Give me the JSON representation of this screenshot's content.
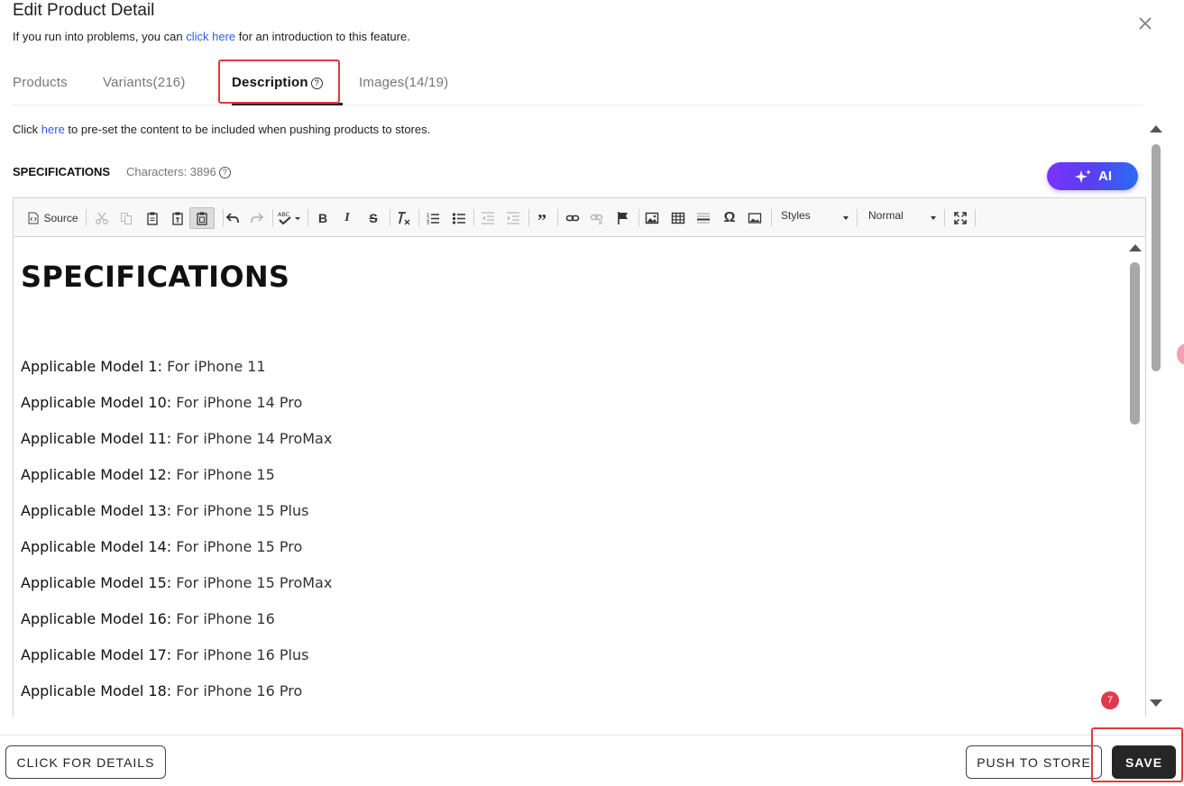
{
  "dialog": {
    "title": "Edit Product Detail",
    "subtitle_before": "If you run into problems, you can ",
    "subtitle_link": "click here",
    "subtitle_after": " for an introduction to this feature."
  },
  "tabs": [
    {
      "label": "Products"
    },
    {
      "label": "Variants(216)"
    },
    {
      "label": "Description",
      "active": true
    },
    {
      "label": "Images(14/19)"
    }
  ],
  "hint": {
    "before": "Click ",
    "link": "here",
    "after": " to pre-set the content to be included when pushing products to stores."
  },
  "specifications": {
    "label": "SPECIFICATIONS",
    "characters": "Characters: 3896"
  },
  "ai_button": {
    "label": "AI",
    "icon": "sparkle-icon"
  },
  "toolbar": {
    "source_label": "Source",
    "styles_label": "Styles",
    "format_label": "Normal"
  },
  "editor": {
    "heading": "SPECIFICATIONS",
    "lines": [
      {
        "key": "Applicable Model 1:",
        "value": " For iPhone 11"
      },
      {
        "key": "Applicable Model 10:",
        "value": " For iPhone 14 Pro"
      },
      {
        "key": "Applicable Model 11:",
        "value": " For iPhone 14 ProMax"
      },
      {
        "key": "Applicable Model 12:",
        "value": " For iPhone 15"
      },
      {
        "key": "Applicable Model 13:",
        "value": " For iPhone 15 Plus"
      },
      {
        "key": "Applicable Model 14:",
        "value": " For iPhone 15 Pro"
      },
      {
        "key": "Applicable Model 15:",
        "value": " For iPhone 15 ProMax"
      },
      {
        "key": "Applicable Model 16:",
        "value": " For iPhone 16"
      },
      {
        "key": "Applicable Model 17:",
        "value": " For iPhone 16 Plus"
      },
      {
        "key": "Applicable Model 18:",
        "value": " For iPhone 16 Pro"
      }
    ]
  },
  "footer": {
    "details_label": "CLICK FOR DETAILS",
    "push_label": "PUSH TO STORE",
    "save_label": "SAVE"
  },
  "notification_badge": "7",
  "colors": {
    "link": "#2f5ee8",
    "highlight": "#e0393e",
    "ai_gradient_start": "#7a33ff",
    "ai_gradient_end": "#2a6cf5",
    "save_bg": "#262626",
    "badge": "#e0394e"
  }
}
